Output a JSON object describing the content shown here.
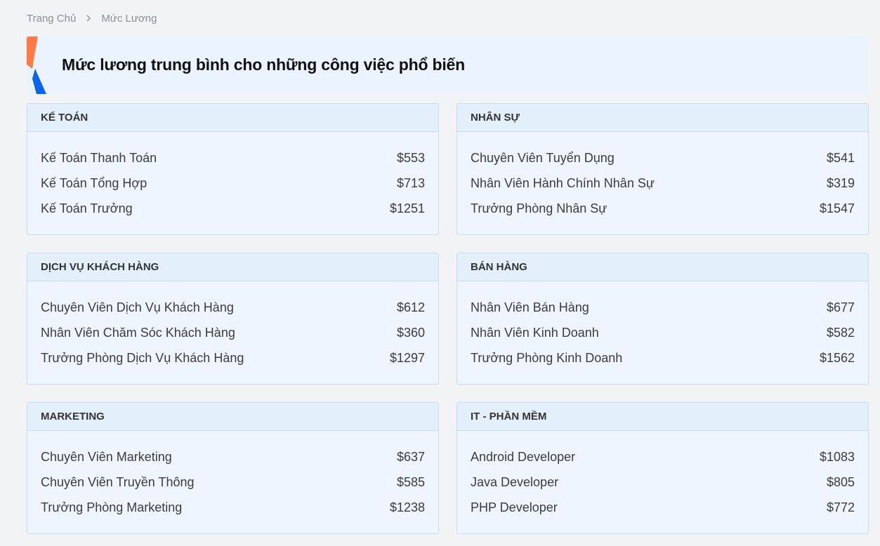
{
  "breadcrumb": {
    "home": "Trang Chủ",
    "current": "Mức Lương"
  },
  "banner": {
    "title": "Mức lương trung bình cho những công việc phổ biến",
    "accent_colors": [
      "#ff7a45",
      "#0a66e8"
    ]
  },
  "categories": [
    {
      "title": "KẾ TOÁN",
      "items": [
        {
          "job": "Kế Toán Thanh Toán",
          "salary": "$553"
        },
        {
          "job": "Kế Toán Tổng Hợp",
          "salary": "$713"
        },
        {
          "job": "Kế Toán Trưởng",
          "salary": "$1251"
        }
      ]
    },
    {
      "title": "NHÂN SỰ",
      "items": [
        {
          "job": "Chuyên Viên Tuyển Dụng",
          "salary": "$541"
        },
        {
          "job": "Nhân Viên Hành Chính Nhân Sự",
          "salary": "$319"
        },
        {
          "job": "Trưởng Phòng Nhân Sự",
          "salary": "$1547"
        }
      ]
    },
    {
      "title": "DỊCH VỤ KHÁCH HÀNG",
      "items": [
        {
          "job": "Chuyên Viên Dịch Vụ Khách Hàng",
          "salary": "$612"
        },
        {
          "job": "Nhân Viên Chăm Sóc Khách Hàng",
          "salary": "$360"
        },
        {
          "job": "Trưởng Phòng Dịch Vụ Khách Hàng",
          "salary": "$1297"
        }
      ]
    },
    {
      "title": "BÁN HÀNG",
      "items": [
        {
          "job": "Nhân Viên Bán Hàng",
          "salary": "$677"
        },
        {
          "job": "Nhân Viên Kinh Doanh",
          "salary": "$582"
        },
        {
          "job": "Trưởng Phòng Kinh Doanh",
          "salary": "$1562"
        }
      ]
    },
    {
      "title": "MARKETING",
      "items": [
        {
          "job": "Chuyên Viên Marketing",
          "salary": "$637"
        },
        {
          "job": "Chuyên Viên Truyền Thông",
          "salary": "$585"
        },
        {
          "job": "Trưởng Phòng Marketing",
          "salary": "$1238"
        }
      ]
    },
    {
      "title": "IT - PHẦN MỀM",
      "items": [
        {
          "job": "Android Developer",
          "salary": "$1083"
        },
        {
          "job": "Java Developer",
          "salary": "$805"
        },
        {
          "job": "PHP Developer",
          "salary": "$772"
        }
      ]
    }
  ]
}
